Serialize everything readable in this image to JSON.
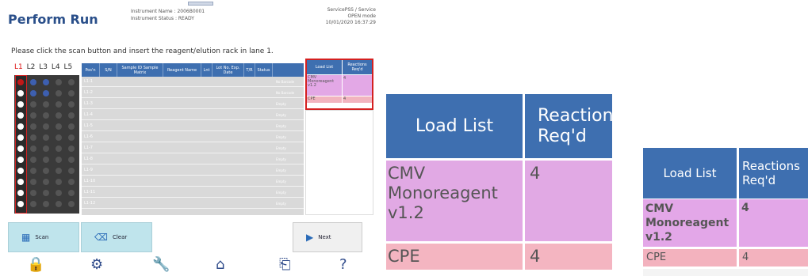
{
  "main": {
    "title": "Perform Run",
    "instrument_name": "Instrument Name : 2006B0001",
    "instrument_status": "Instrument Status : READY",
    "user": "ServicePSS / Service",
    "mode": "OPEN mode",
    "datetime": "10/01/2020 16:37:29",
    "instruction": "Please click the scan button and insert the reagent/elution rack in lane 1.",
    "lanes": [
      "L1",
      "L2",
      "L3",
      "L4",
      "L5"
    ],
    "grid_headers": [
      "Pos'n",
      "S/N",
      "Sample ID\nSample Matrix",
      "Reagent Name",
      "Lnt",
      "Lot No.\nExp. Date",
      "T/R",
      "Status"
    ],
    "positions": [
      "L1-1",
      "L1-2",
      "L1-3",
      "L1-4",
      "L1-5",
      "L1-6",
      "L1-7",
      "L1-8",
      "L1-9",
      "L1-10",
      "L1-11",
      "L1-12"
    ],
    "statuses": [
      "No Barcode",
      "No Barcode",
      "Empty",
      "Empty",
      "Empty",
      "Empty",
      "Empty",
      "Empty",
      "Empty",
      "Empty",
      "Empty",
      "Empty"
    ],
    "buttons": {
      "scan": "Scan",
      "clear": "Clear",
      "next": "Next"
    },
    "bottom_icons": [
      "lock-icon",
      "gear-icon",
      "wrench-icon",
      "home-icon",
      "exit-icon",
      "help-icon"
    ]
  },
  "load_list": {
    "col1": "Load List",
    "col2": "Reactions Req'd",
    "col2_line1": "Reactions",
    "col2_line2": "Req'd",
    "rows": [
      {
        "name": "CMV Monoreagent v1.2",
        "name_l1": "CMV",
        "name_l2": "Monoreagent",
        "name_l3": "v1.2",
        "reactions": "4"
      },
      {
        "name": "CPE",
        "reactions": "4"
      }
    ]
  },
  "colors": {
    "header_blue": "#3e6fb0",
    "row_purple": "#e1a9e4",
    "row_pink": "#f4b5c1",
    "highlight_red": "#d42020"
  }
}
